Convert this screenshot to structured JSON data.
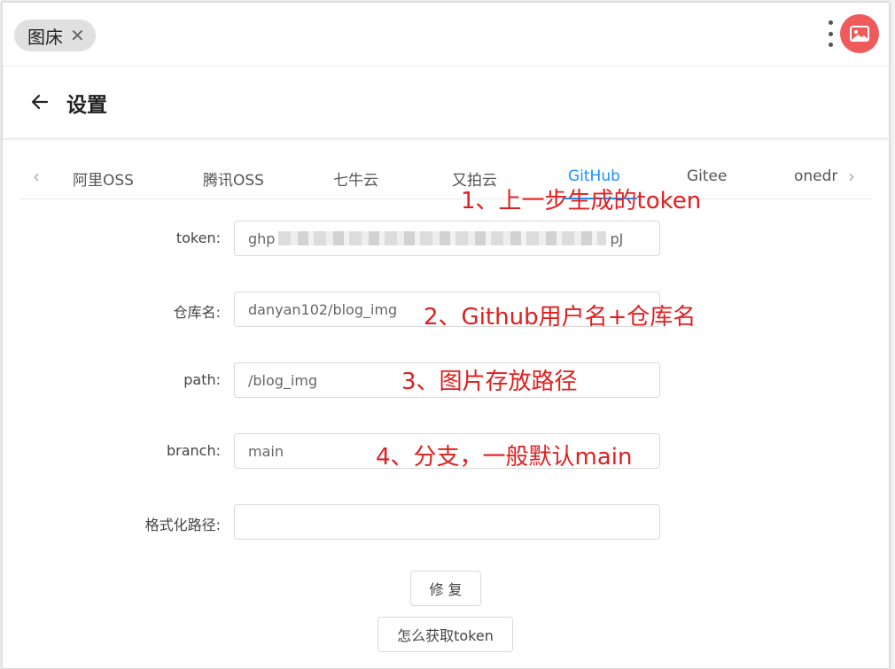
{
  "topbar": {
    "chip_label": "图床",
    "chip_close": "✕"
  },
  "header": {
    "title": "设置"
  },
  "tabs": {
    "prev": "‹",
    "next": "›",
    "items": [
      "阿里OSS",
      "腾讯OSS",
      "七牛云",
      "又拍云",
      "GitHub",
      "Gitee",
      "onedr"
    ],
    "active": "GitHub"
  },
  "form": {
    "token": {
      "label": "token:",
      "value_start": "ghp",
      "value_end": "pJ"
    },
    "repo": {
      "label": "仓库名:",
      "value": "danyan102/blog_img"
    },
    "path": {
      "label": "path:",
      "value": "/blog_img"
    },
    "branch": {
      "label": "branch:",
      "value": "main"
    },
    "format_path": {
      "label": "格式化路径:",
      "value": ""
    }
  },
  "buttons": {
    "repair": "修 复",
    "how_token": "怎么获取token"
  },
  "annotations": {
    "a1": "1、上一步生成的token",
    "a2": "2、Github用户名+仓库名",
    "a3": "3、图片存放路径",
    "a4": "4、分支，一般默认main"
  },
  "colors": {
    "accent": "#1890ff",
    "annotation": "#e02020",
    "avatar": "#ef5a5a"
  }
}
